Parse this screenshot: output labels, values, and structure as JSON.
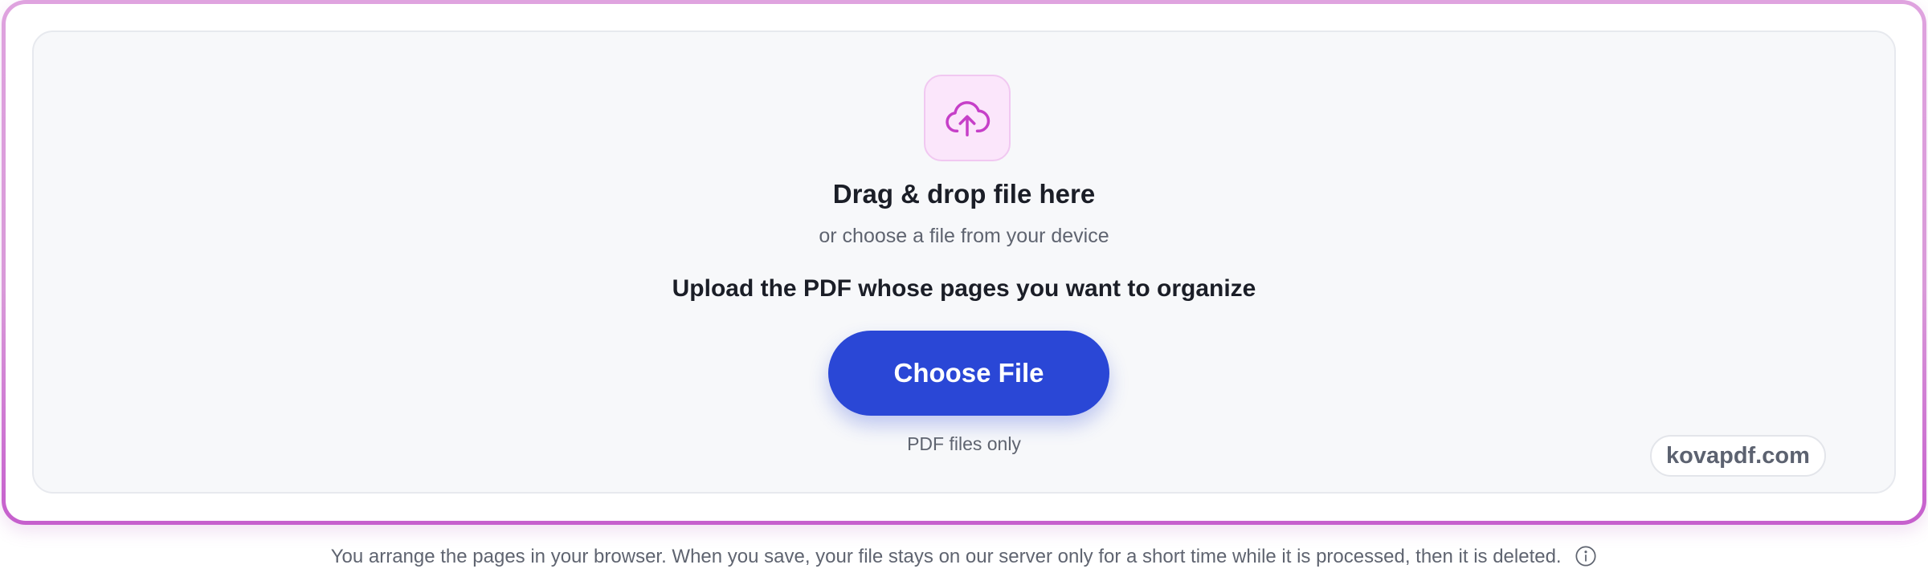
{
  "upload": {
    "icon": "cloud-upload-icon",
    "heading": "Drag & drop file here",
    "subheading": "or choose a file from your device",
    "instruction": "Upload the PDF whose pages you want to organize",
    "button_label": "Choose File",
    "file_hint": "PDF files only",
    "watermark": "kovapdf.com"
  },
  "footer": {
    "text": "You arrange the pages in your browser. When you save, your file stays on our server only for a short time while it is processed, then it is deleted.",
    "info_icon": "info-icon"
  },
  "colors": {
    "accent": "#2a47d6",
    "frame_border": "#d99ad9",
    "icon_tint": "#c63fc8"
  }
}
